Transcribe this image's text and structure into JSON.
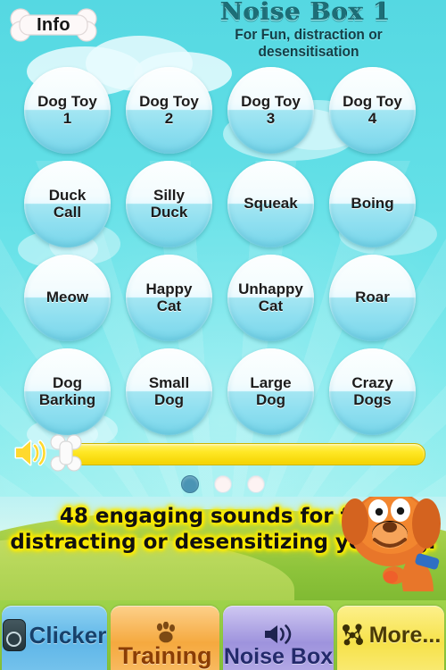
{
  "header": {
    "info_button_label": "Info",
    "info_icon": "bone-icon",
    "title": "Noise Box 1",
    "subtitle": "For Fun, distraction or desensitisation"
  },
  "grid": {
    "buttons": [
      {
        "line1": "Dog Toy",
        "line2": "1"
      },
      {
        "line1": "Dog Toy",
        "line2": "2"
      },
      {
        "line1": "Dog Toy",
        "line2": "3"
      },
      {
        "line1": "Dog Toy",
        "line2": "4"
      },
      {
        "line1": "Duck",
        "line2": "Call"
      },
      {
        "line1": "Silly",
        "line2": "Duck"
      },
      {
        "line1": "Squeak",
        "line2": ""
      },
      {
        "line1": "Boing",
        "line2": ""
      },
      {
        "line1": "Meow",
        "line2": ""
      },
      {
        "line1": "Happy",
        "line2": "Cat"
      },
      {
        "line1": "Unhappy",
        "line2": "Cat"
      },
      {
        "line1": "Roar",
        "line2": ""
      },
      {
        "line1": "Dog",
        "line2": "Barking"
      },
      {
        "line1": "Small",
        "line2": "Dog"
      },
      {
        "line1": "Large",
        "line2": "Dog"
      },
      {
        "line1": "Crazy",
        "line2": "Dogs"
      }
    ]
  },
  "volume": {
    "speaker_icon": "speaker-icon",
    "thumb_icon": "bone-slider-thumb-icon",
    "value": 0,
    "track_color": "#ffe826"
  },
  "pager": {
    "total": 3,
    "active": 1,
    "active_color": "#4a94b4"
  },
  "promo": {
    "line1": "48 engaging sounds for fun,",
    "line2": "distracting or desensitizing you dog.",
    "glow_color": "#fff200",
    "dog_illustration": "dog-illustration"
  },
  "tabbar": {
    "background_color": "#8ec33a",
    "tabs": [
      {
        "label": "Clicker",
        "icon": "clicker-device-icon",
        "color": "#5fb6e8",
        "selected": false
      },
      {
        "label": "Training",
        "icon": "paw-print-icon",
        "color": "#f5a93f",
        "selected": false
      },
      {
        "label": "Noise Box",
        "icon": "speaker-icon",
        "color": "#9e93dd",
        "selected": true
      },
      {
        "label": "More...",
        "icon": "more-apps-icon",
        "color": "#f6e24a",
        "selected": false
      }
    ]
  }
}
